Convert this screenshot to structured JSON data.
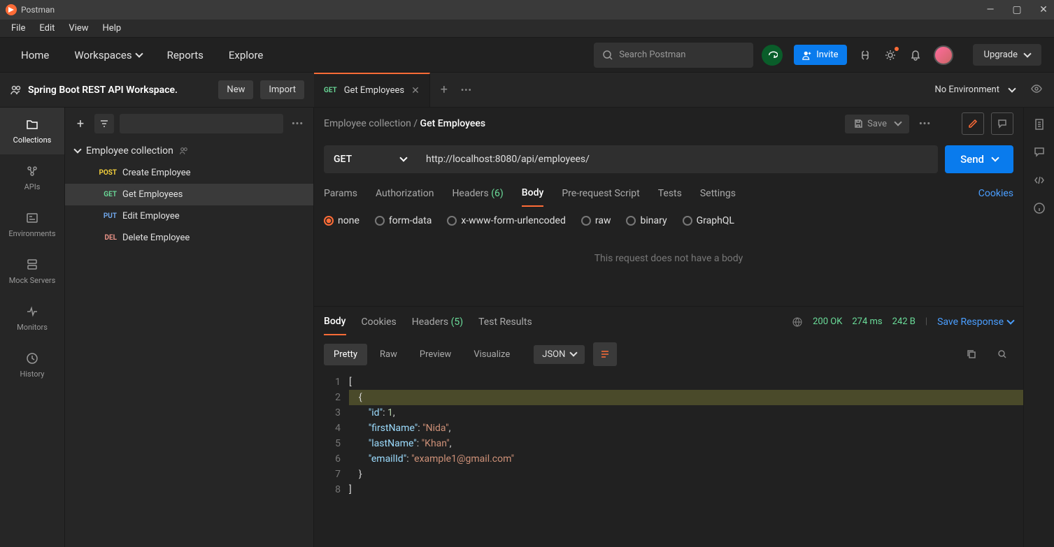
{
  "titlebar": {
    "title": "Postman"
  },
  "menubar": {
    "items": [
      "File",
      "Edit",
      "View",
      "Help"
    ]
  },
  "topnav": {
    "home": "Home",
    "workspaces": "Workspaces",
    "reports": "Reports",
    "explore": "Explore",
    "search_placeholder": "Search Postman",
    "invite": "Invite",
    "upgrade": "Upgrade"
  },
  "workspace": {
    "name": "Spring Boot REST API Workspace.",
    "new_btn": "New",
    "import_btn": "Import"
  },
  "tabs": {
    "active": {
      "method": "GET",
      "name": "Get Employees"
    }
  },
  "environment": {
    "selected": "No Environment"
  },
  "rail": {
    "collections": "Collections",
    "apis": "APIs",
    "environments": "Environments",
    "mock_servers": "Mock Servers",
    "monitors": "Monitors",
    "history": "History"
  },
  "sidebar": {
    "collection_name": "Employee collection",
    "requests": [
      {
        "method": "POST",
        "name": "Create Employee"
      },
      {
        "method": "GET",
        "name": "Get Employees"
      },
      {
        "method": "PUT",
        "name": "Edit Employee"
      },
      {
        "method": "DEL",
        "name": "Delete Employee"
      }
    ]
  },
  "breadcrumb": {
    "collection": "Employee collection",
    "request": "Get Employees",
    "save": "Save"
  },
  "request": {
    "method": "GET",
    "url": "http://localhost:8080/api/employees/",
    "send": "Send",
    "tabs": {
      "params": "Params",
      "auth": "Authorization",
      "headers": "Headers",
      "headers_count": "(6)",
      "body": "Body",
      "prereq": "Pre-request Script",
      "tests": "Tests",
      "settings": "Settings",
      "cookies": "Cookies"
    },
    "body_types": {
      "none": "none",
      "formdata": "form-data",
      "urlencoded": "x-www-form-urlencoded",
      "raw": "raw",
      "binary": "binary",
      "graphql": "GraphQL"
    },
    "no_body_message": "This request does not have a body"
  },
  "response": {
    "tabs": {
      "body": "Body",
      "cookies": "Cookies",
      "headers": "Headers",
      "headers_count": "(5)",
      "test_results": "Test Results"
    },
    "status_code": "200",
    "status_text": "OK",
    "time": "274 ms",
    "size": "242 B",
    "save_response": "Save Response",
    "views": {
      "pretty": "Pretty",
      "raw": "Raw",
      "preview": "Preview",
      "visualize": "Visualize"
    },
    "format": "JSON",
    "body": {
      "data": [
        {
          "id": 1,
          "firstName": "Nida",
          "lastName": "Khan",
          "emailId": "example1@gmail.com"
        }
      ],
      "lines": [
        {
          "n": 1,
          "text": "["
        },
        {
          "n": 2,
          "text": "    {",
          "highlight": true
        },
        {
          "n": 3,
          "key": "id",
          "num": "1",
          "comma": true,
          "indent": 8
        },
        {
          "n": 4,
          "key": "firstName",
          "str": "Nida",
          "comma": true,
          "indent": 8
        },
        {
          "n": 5,
          "key": "lastName",
          "str": "Khan",
          "comma": true,
          "indent": 8
        },
        {
          "n": 6,
          "key": "emailId",
          "str": "example1@gmail.com",
          "indent": 8
        },
        {
          "n": 7,
          "text": "    }"
        },
        {
          "n": 8,
          "text": "]"
        }
      ]
    }
  }
}
